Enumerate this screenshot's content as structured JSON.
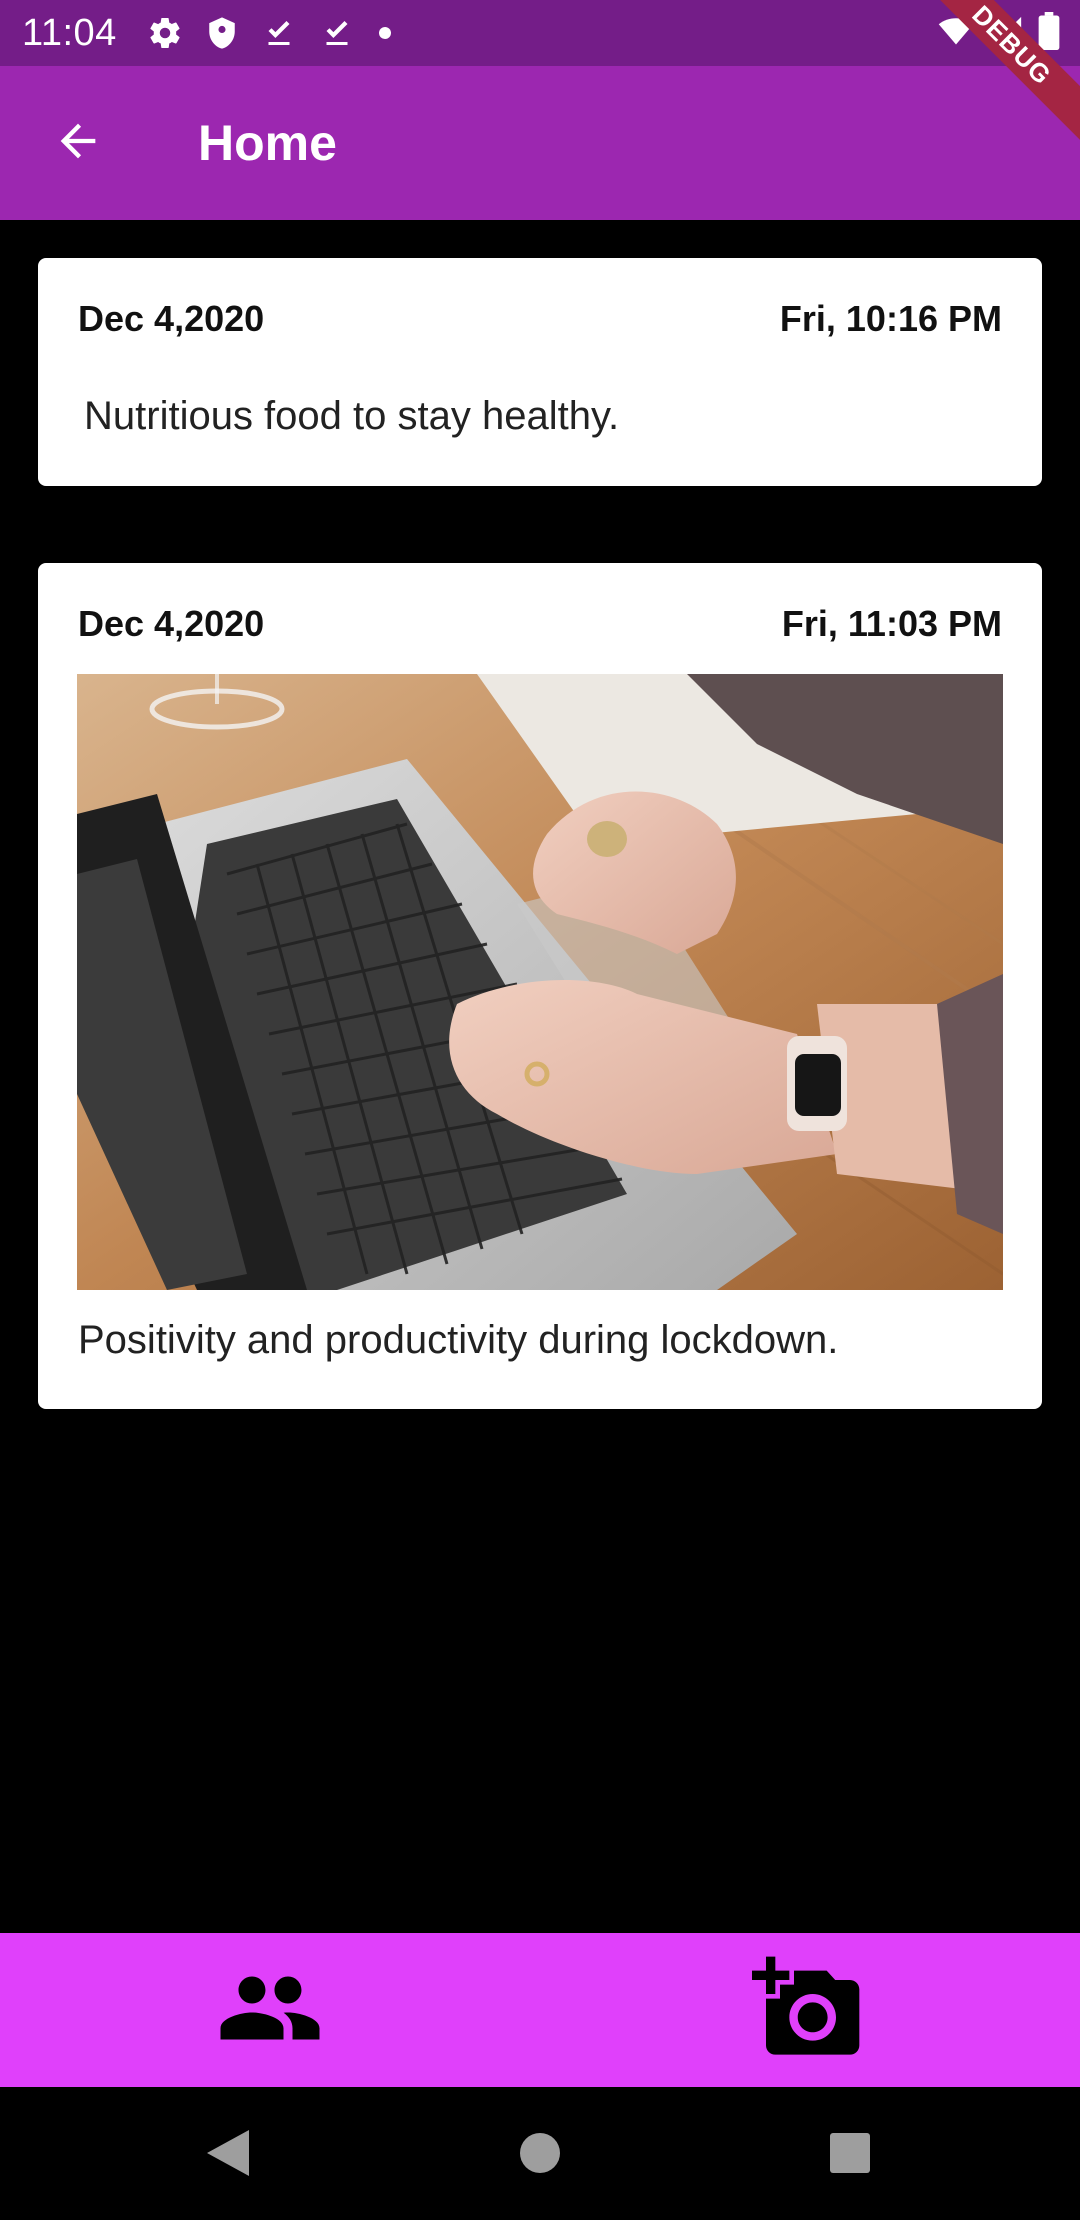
{
  "status_bar": {
    "time": "11:04",
    "icons": [
      "gear-icon",
      "shield-icon",
      "download-done-icon",
      "download-done-icon",
      "dot-icon",
      "wifi-icon",
      "signal-icon",
      "battery-icon"
    ]
  },
  "debug_banner": {
    "label": "DEBUG"
  },
  "app_bar": {
    "title": "Home",
    "back_icon": "arrow-back-icon"
  },
  "posts": [
    {
      "date": "Dec 4,2020",
      "time": "Fri, 10:16 PM",
      "text": "Nutritious food to stay healthy."
    },
    {
      "date": "Dec 4,2020",
      "time": "Fri, 11:03 PM",
      "text": "Positivity and productivity during lockdown.",
      "image": "photo-laptop-typing"
    }
  ],
  "bottom_nav": {
    "items": [
      {
        "icon": "people-icon"
      },
      {
        "icon": "add-a-photo-icon"
      }
    ]
  },
  "system_nav": {
    "items": [
      {
        "icon": "back-triangle-icon"
      },
      {
        "icon": "home-circle-icon"
      },
      {
        "icon": "recents-square-icon"
      }
    ]
  },
  "colors": {
    "status_bar": "#741d88",
    "app_bar": "#9c27b0",
    "bottom_nav": "#e040fb",
    "background": "#000000",
    "card": "#ffffff",
    "debug_banner": "#a42543"
  }
}
